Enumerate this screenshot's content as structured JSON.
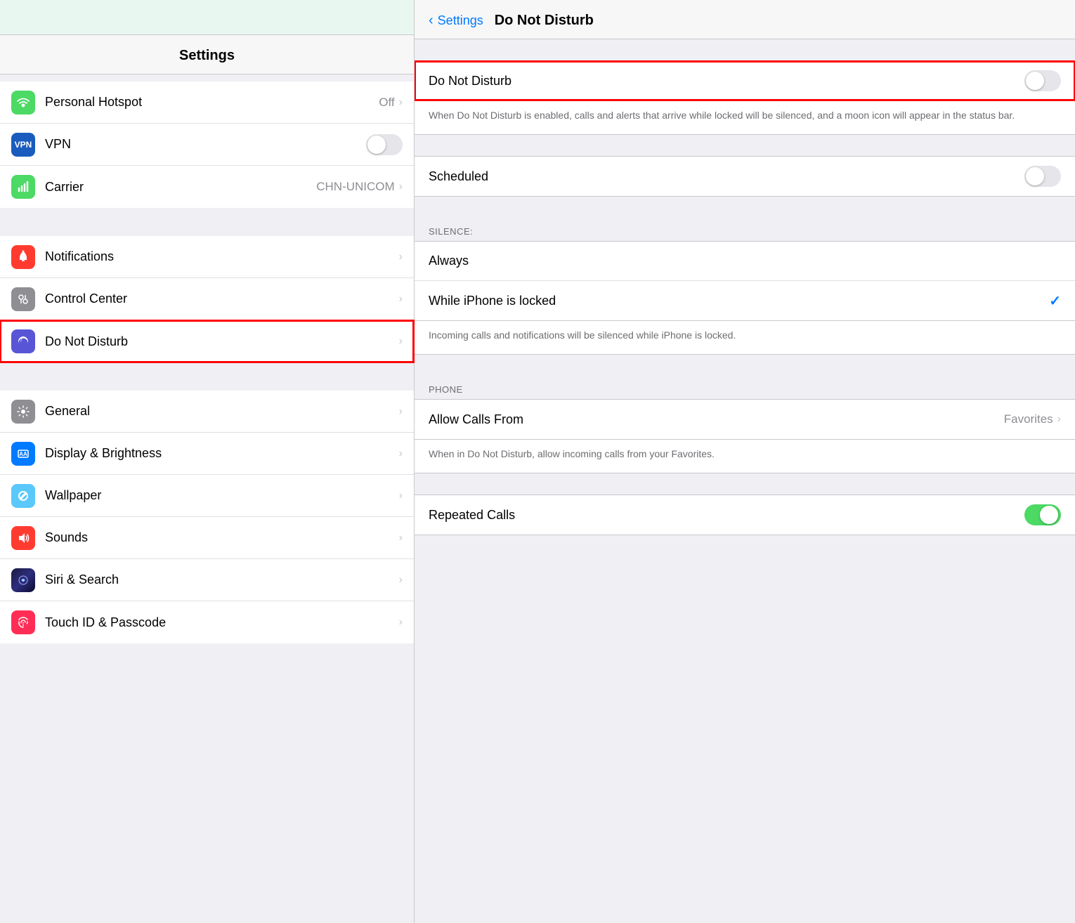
{
  "left": {
    "title": "Settings",
    "topIconColor": "#b2f0d8",
    "rows_group1": [
      {
        "id": "hotspot",
        "label": "Personal Hotspot",
        "value": "Off",
        "iconBg": "#4cd964",
        "iconType": "hotspot",
        "hasChevron": true,
        "hasToggle": false
      },
      {
        "id": "vpn",
        "label": "VPN",
        "value": "",
        "iconBg": "#007aff",
        "iconType": "vpn",
        "hasChevron": false,
        "hasToggle": true
      },
      {
        "id": "carrier",
        "label": "Carrier",
        "value": "CHN-UNICOM",
        "iconBg": "#4cd964",
        "iconType": "carrier",
        "hasChevron": true,
        "hasToggle": false
      }
    ],
    "rows_group2": [
      {
        "id": "notifications",
        "label": "Notifications",
        "iconBg": "#ff3b30",
        "iconType": "notifications",
        "hasChevron": true
      },
      {
        "id": "control-center",
        "label": "Control Center",
        "iconBg": "#8e8e93",
        "iconType": "control-center",
        "hasChevron": true
      },
      {
        "id": "do-not-disturb",
        "label": "Do Not Disturb",
        "iconBg": "#5856d6",
        "iconType": "moon",
        "hasChevron": true,
        "highlighted": false,
        "redBorder": true
      }
    ],
    "rows_group3": [
      {
        "id": "general",
        "label": "General",
        "iconBg": "#8e8e93",
        "iconType": "general",
        "hasChevron": true
      },
      {
        "id": "display-brightness",
        "label": "Display & Brightness",
        "iconBg": "#007aff",
        "iconType": "display",
        "hasChevron": true
      },
      {
        "id": "wallpaper",
        "label": "Wallpaper",
        "iconBg": "#5ac8fa",
        "iconType": "wallpaper",
        "hasChevron": true
      },
      {
        "id": "sounds",
        "label": "Sounds",
        "iconBg": "#ff3b30",
        "iconType": "sounds",
        "hasChevron": true
      },
      {
        "id": "siri-search",
        "label": "Siri & Search",
        "iconBg": "#1a1a2e",
        "iconType": "siri",
        "hasChevron": true
      },
      {
        "id": "touch-id",
        "label": "Touch ID & Passcode",
        "iconBg": "#ff2d55",
        "iconType": "touch-id",
        "hasChevron": true
      }
    ]
  },
  "right": {
    "back_label": "Settings",
    "title": "Do Not Disturb",
    "do_not_disturb_label": "Do Not Disturb",
    "do_not_disturb_desc": "When Do Not Disturb is enabled, calls and alerts that arrive while locked will be silenced, and a moon icon will appear in the status bar.",
    "scheduled_label": "Scheduled",
    "silence_section_label": "SILENCE:",
    "always_label": "Always",
    "while_locked_label": "While iPhone is locked",
    "locked_desc": "Incoming calls and notifications will be silenced while iPhone is locked.",
    "phone_section_label": "PHONE",
    "allow_calls_label": "Allow Calls From",
    "allow_calls_value": "Favorites",
    "allow_calls_desc": "When in Do Not Disturb, allow incoming calls from your Favorites.",
    "repeated_calls_label": "Repeated Calls"
  }
}
